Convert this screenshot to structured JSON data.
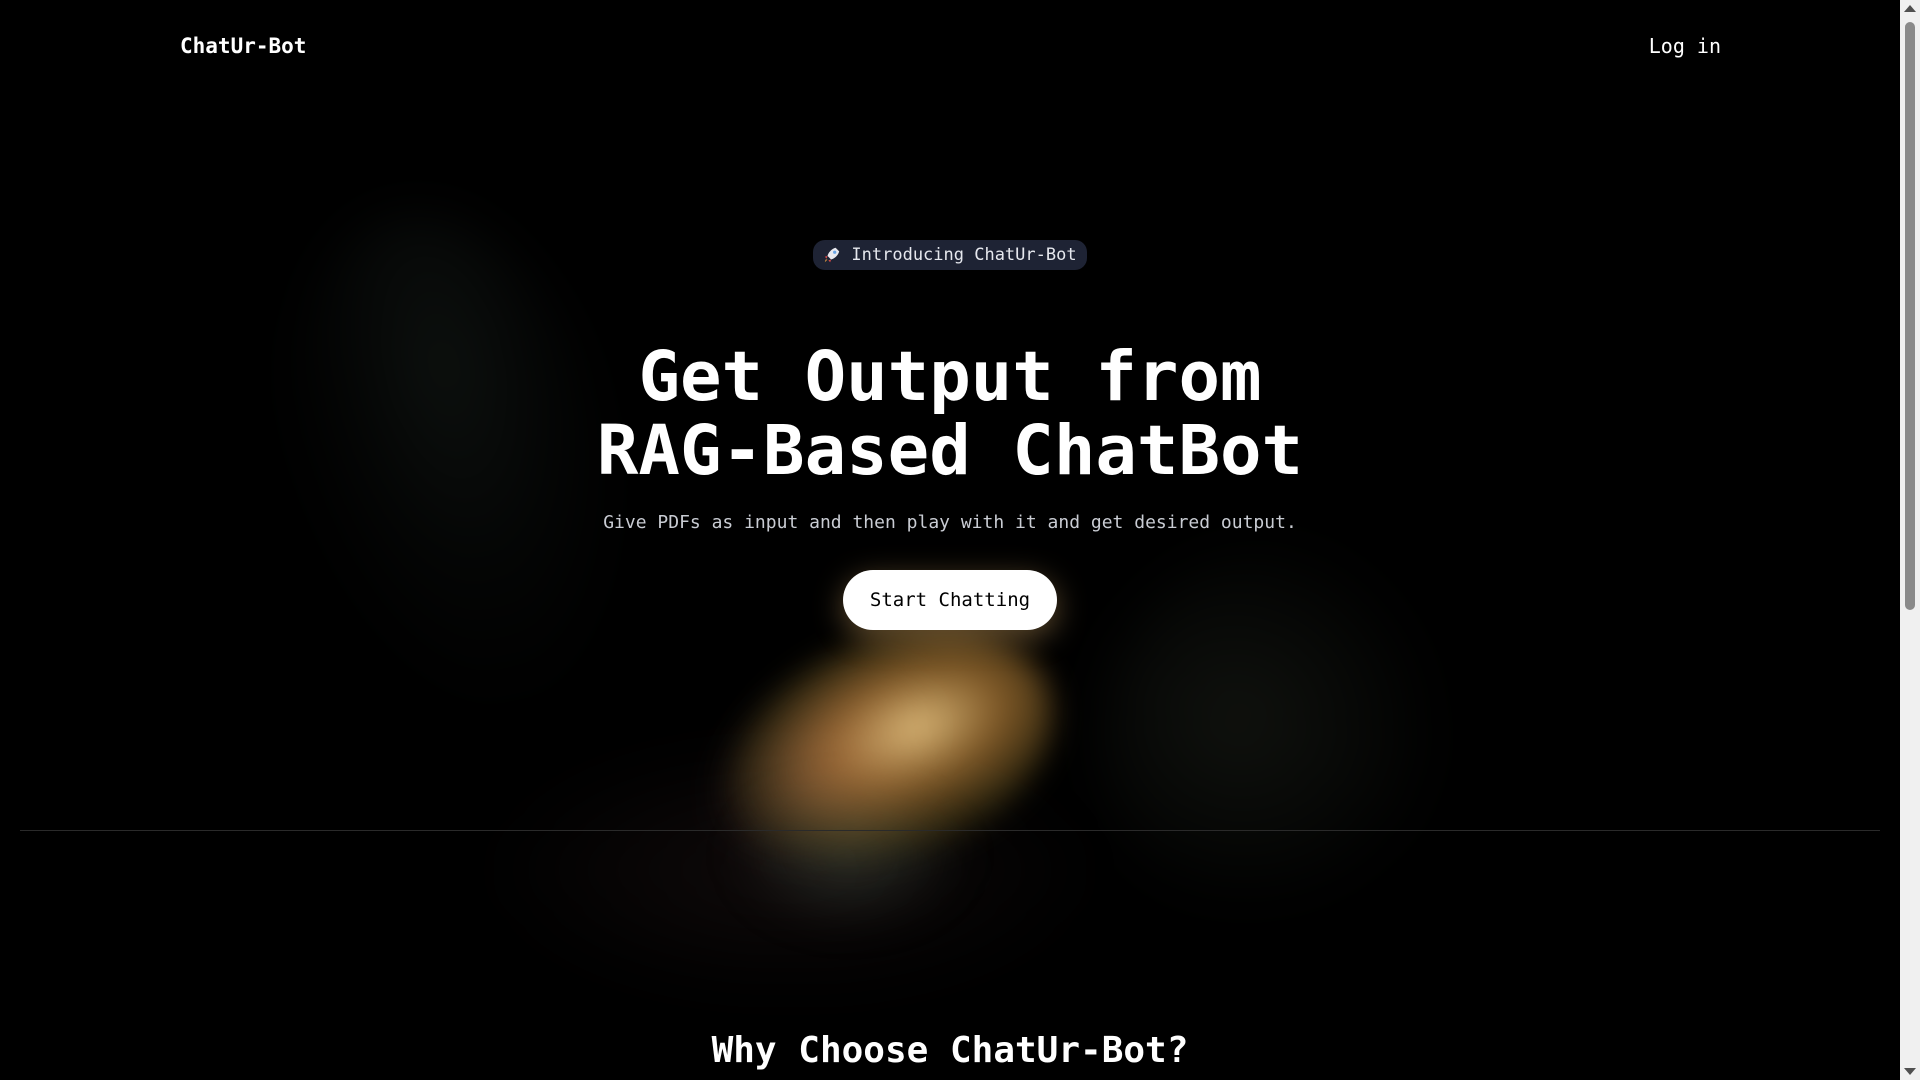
{
  "nav": {
    "brand": "ChatUr-Bot",
    "login_label": "Log in"
  },
  "hero": {
    "badge_icon": "rocket-icon",
    "badge_text": "Introducing ChatUr-Bot",
    "headline_line1": "Get Output from",
    "headline_line2": "RAG-Based ChatBot",
    "subtitle": "Give PDFs as input and then play with it and get desired output.",
    "cta_label": "Start Chatting"
  },
  "features": {
    "heading": "Why Choose ChatUr-Bot?"
  },
  "colors": {
    "background": "#000000",
    "badge_bg": "#1e2334",
    "cta_bg": "#ffffff",
    "glow": "#f5c27a"
  }
}
